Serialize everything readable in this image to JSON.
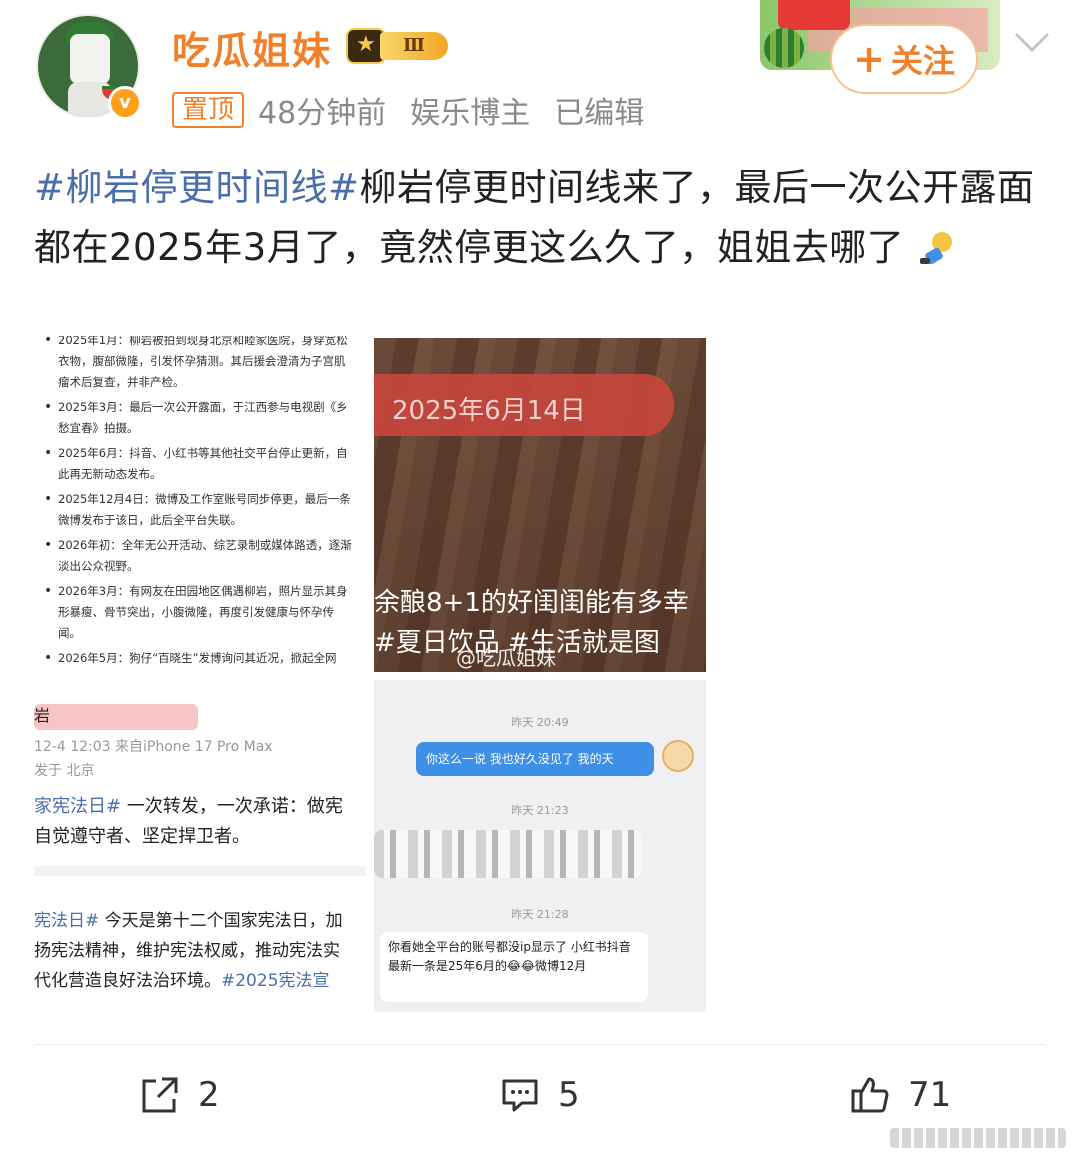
{
  "user": {
    "name": "吃瓜姐妹",
    "level_badge": "Ⅲ"
  },
  "meta": {
    "pinned_label": "置顶",
    "time": "48分钟前",
    "category": "娱乐博主",
    "edited": "已编辑"
  },
  "follow": {
    "label": "关注"
  },
  "post": {
    "topic": "#柳岩停更时间线#",
    "text": "柳岩停更时间线来了，最后一次公开露面都在2025年3月了，竟然停更这么久了，姐姐去哪了"
  },
  "images": {
    "timeline": [
      "2025年1月：柳岩被拍到现身北京和睦家医院，身穿宽松衣物，腹部微隆，引发怀孕猜测。其后援会澄清为子宫肌瘤术后复查，并非产检。",
      "2025年3月：最后一次公开露面，于江西参与电视剧《乡愁宜春》拍摄。",
      "2025年6月：抖音、小红书等其他社交平台停止更新，自此再无新动态发布。",
      "2025年12月4日：微博及工作室账号同步停更，最后一条微博发布于该日，此后全平台失联。",
      "2026年初：全年无公开活动、综艺录制或媒体路透，逐渐淡出公众视野。",
      "2026年3月：有网友在田园地区偶遇柳岩，照片显示其身形暴瘦、骨节突出，小腹微隆，再度引发健康与怀孕传闻。",
      "2026年5月：狗仔“百晓生”发博询问其近况，掀起全网"
    ],
    "photo": {
      "date_stamp": "2025年6月14日",
      "caption_1": "余酿8+1的好闺闺能有多幸",
      "caption_2": "#夏日饮品 #生活就是图",
      "watermark": "@吃瓜姐妹"
    },
    "weibo": {
      "name": "岩",
      "time_source": "12-4 12:03  来自iPhone 17 Pro Max",
      "location": "发于 北京",
      "line1_topic": "家宪法日#",
      "line1_text": "一次转发，一次承诺：做宪",
      "line2": "自觉遵守者、坚定捍卫者。",
      "q1_topic": "宪法日#",
      "q1_text": "今天是第十二个国家宪法日，加",
      "q2": "扬宪法精神，维护宪法权威，推动宪法实",
      "q3_text": "代化营造良好法治环境。",
      "q3_topic": "#2025宪法宣"
    },
    "chat": {
      "time1": "昨天 20:49",
      "msg1": "你这么一说 我也好久没见了 我的天",
      "time2": "昨天 21:23",
      "time3": "昨天 21:28",
      "msg3": "你看她全平台的账号都没ip显示了 小红书抖音最新一条是25年6月的😂😂微博12月"
    }
  },
  "actions": {
    "repost_count": "2",
    "comment_count": "5",
    "like_count": "71"
  },
  "colors": {
    "accent": "#f0812c",
    "topic": "#4a6fa8",
    "meta_gray": "#8a8a8a"
  }
}
